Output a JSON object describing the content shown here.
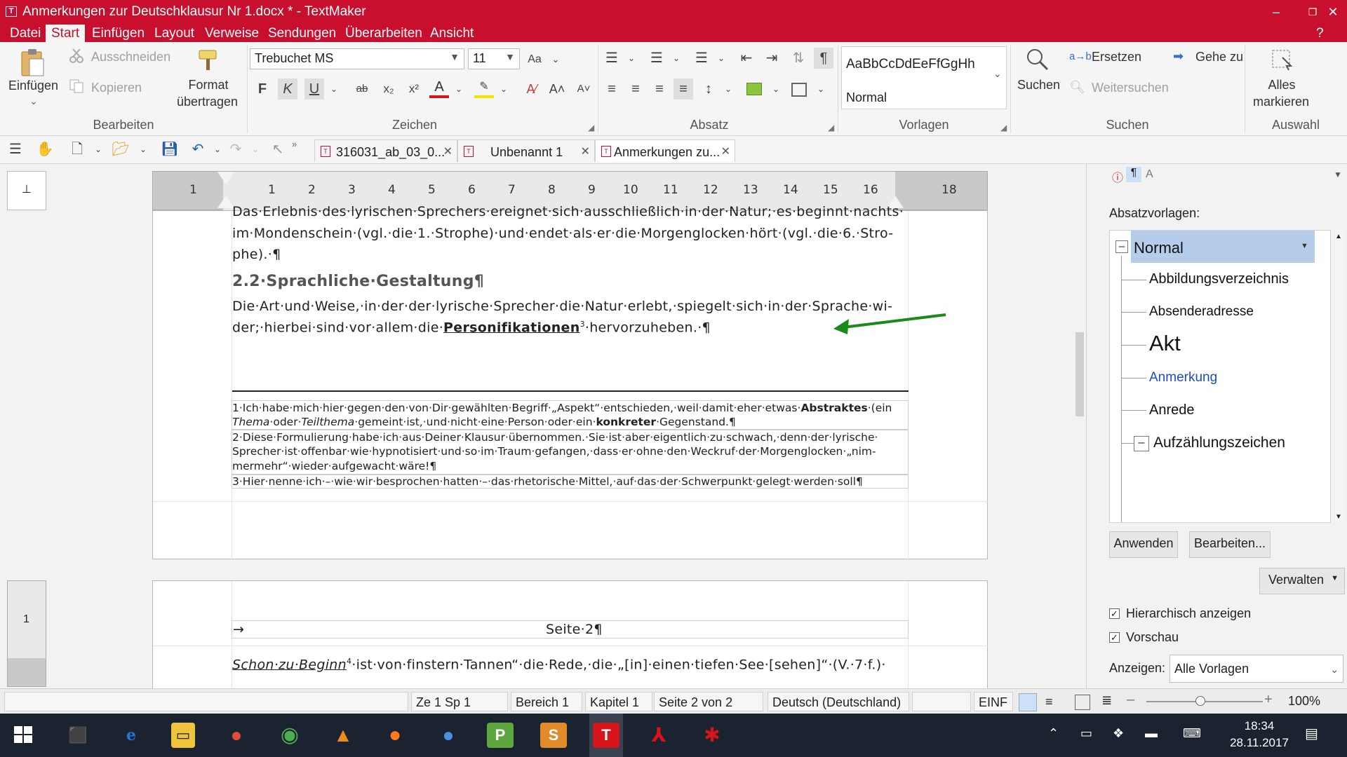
{
  "window": {
    "title": "Anmerkungen zur Deutschklausur Nr 1.docx * - TextMaker",
    "app_icon": "T",
    "controls": [
      "–",
      "❐",
      "✕"
    ]
  },
  "menu": [
    "Datei",
    "Start",
    "Einfügen",
    "Layout",
    "Verweise",
    "Sendungen",
    "Überarbeiten",
    "Ansicht"
  ],
  "menu_help": "?",
  "ribbon": {
    "bearbeiten": {
      "paste": "Einfügen",
      "cut": "Ausschneiden",
      "copy": "Kopieren",
      "format_copy_1": "Format",
      "format_copy_2": "übertragen",
      "group": "Bearbeiten"
    },
    "zeichen": {
      "font": "Trebuchet MS",
      "size": "11",
      "bold": "F",
      "italic": "K",
      "underline": "U",
      "strike": "ab",
      "sub": "x₂",
      "sup": "x²",
      "color": "A",
      "group": "Zeichen"
    },
    "absatz": {
      "group": "Absatz"
    },
    "vorlagen": {
      "preview": "AaBbCcDdEeFfGgHh",
      "current": "Normal",
      "group": "Vorlagen"
    },
    "suchen": {
      "search": "Suchen",
      "replace": "Ersetzen",
      "goto": "Gehe zu",
      "next": "Weitersuchen",
      "group": "Suchen"
    },
    "auswahl": {
      "select_all_1": "Alles",
      "select_all_2": "markieren",
      "group": "Auswahl"
    }
  },
  "tabs": [
    {
      "label": "316031_ab_03_0..."
    },
    {
      "label": "Unbenannt 1"
    },
    {
      "label": "Anmerkungen zu..."
    }
  ],
  "ruler": {
    "left_marks": [
      "1"
    ],
    "marks": [
      "1",
      "2",
      "3",
      "4",
      "5",
      "6",
      "7",
      "8",
      "9",
      "10",
      "11",
      "12",
      "13",
      "14",
      "15",
      "16",
      "18"
    ]
  },
  "document": {
    "line0": "Das·Erlebnis·des·lyrischen·Sprechers·ereignet·sich·ausschließlich·in·der·Natur;·es·beginnt·nachts·",
    "line1": "im·Mondenschein·(vgl.·die·1.·Strophe)·und·endet·als·er·die·Morgenglocken·hört·(vgl.·die·6.·Stro-",
    "line2": "phe).·¶",
    "heading": "2.2·Sprachliche·Gestaltung¶",
    "para1": "Die·Art·und·Weise,·in·der·der·lyrische·Sprecher·die·Natur·erlebt,·spiegelt·sich·in·der·Sprache·wi-",
    "para2_a": "der;·hierbei·sind·vor·allem·die·",
    "para2_link": "Personifikationen",
    "para2_sup": "3",
    "para2_b": "·hervorzuheben.·¶",
    "fn1_a": "1·Ich·habe·mich·hier·gegen·den·von·Dir·gewählten·Begriff·„Aspekt“·entschieden,·weil·damit·eher·etwas·",
    "fn1_bold": "Abstraktes",
    "fn1_c": "·(ein",
    "fn1_line2_i1": "Thema",
    "fn1_line2_b": "·oder·",
    "fn1_line2_i2": "Teilthema",
    "fn1_line2_c": "·gemeint·ist,·und·nicht·eine·Person·oder·ein·",
    "fn1_line2_bold": "konkreter",
    "fn1_line2_d": "·Gegenstand.¶",
    "fn2_l1": "2·Diese·Formulierung·habe·ich·aus·Deiner·Klausur·übernommen.·Sie·ist·aber·eigentlich·zu·schwach,·denn·der·lyrische·",
    "fn2_l2": "Sprecher·ist·offenbar·wie·hypnotisiert·und·so·im·Traum·gefangen,·dass·er·ohne·den·Weckruf·der·Morgenglocken·„nim-",
    "fn2_l3": "mermehr“·wieder·aufgewacht·wäre!¶",
    "fn3": "3·Hier·nenne·ich·–·wie·wir·besprochen·hatten·–·das·rhetorische·Mittel,·auf·das·der·Schwerpunkt·gelegt·werden·soll¶",
    "header_arrow": "→",
    "header": "Seite·2¶",
    "p2_link": "Schon·zu·Beginn",
    "p2_sup": "4",
    "p2_rest": "·ist·von·finstern·Tannen“·die·Rede,·die·„[in]·einen·tiefen·See·[sehen]“·(V.·7·f.)·"
  },
  "sidebar": {
    "label": "Absatzvorlagen:",
    "styles": [
      "Normal",
      "Abbildungsverzeichnis",
      "Absenderadresse",
      "Akt",
      "Anmerkung",
      "Anrede",
      "Aufzählungszeichen"
    ],
    "apply": "Anwenden",
    "edit": "Bearbeiten...",
    "manage": "Verwalten",
    "hier": "Hierarchisch anzeigen",
    "preview": "Vorschau",
    "show_label": "Anzeigen:",
    "show_value": "Alle Vorlagen"
  },
  "status": {
    "pos": "Ze 1 Sp 1",
    "area": "Bereich 1",
    "chapter": "Kapitel 1",
    "page": "Seite 2 von 2",
    "lang": "Deutsch (Deutschland)",
    "mode": "EINF",
    "zoom": "100%"
  },
  "taskbar": {
    "time": "18:34",
    "date": "28.11.2017"
  },
  "colors": {
    "brand": "#c8102e",
    "accent_blue": "#1f49c0",
    "arrow": "#1a8a1a"
  }
}
